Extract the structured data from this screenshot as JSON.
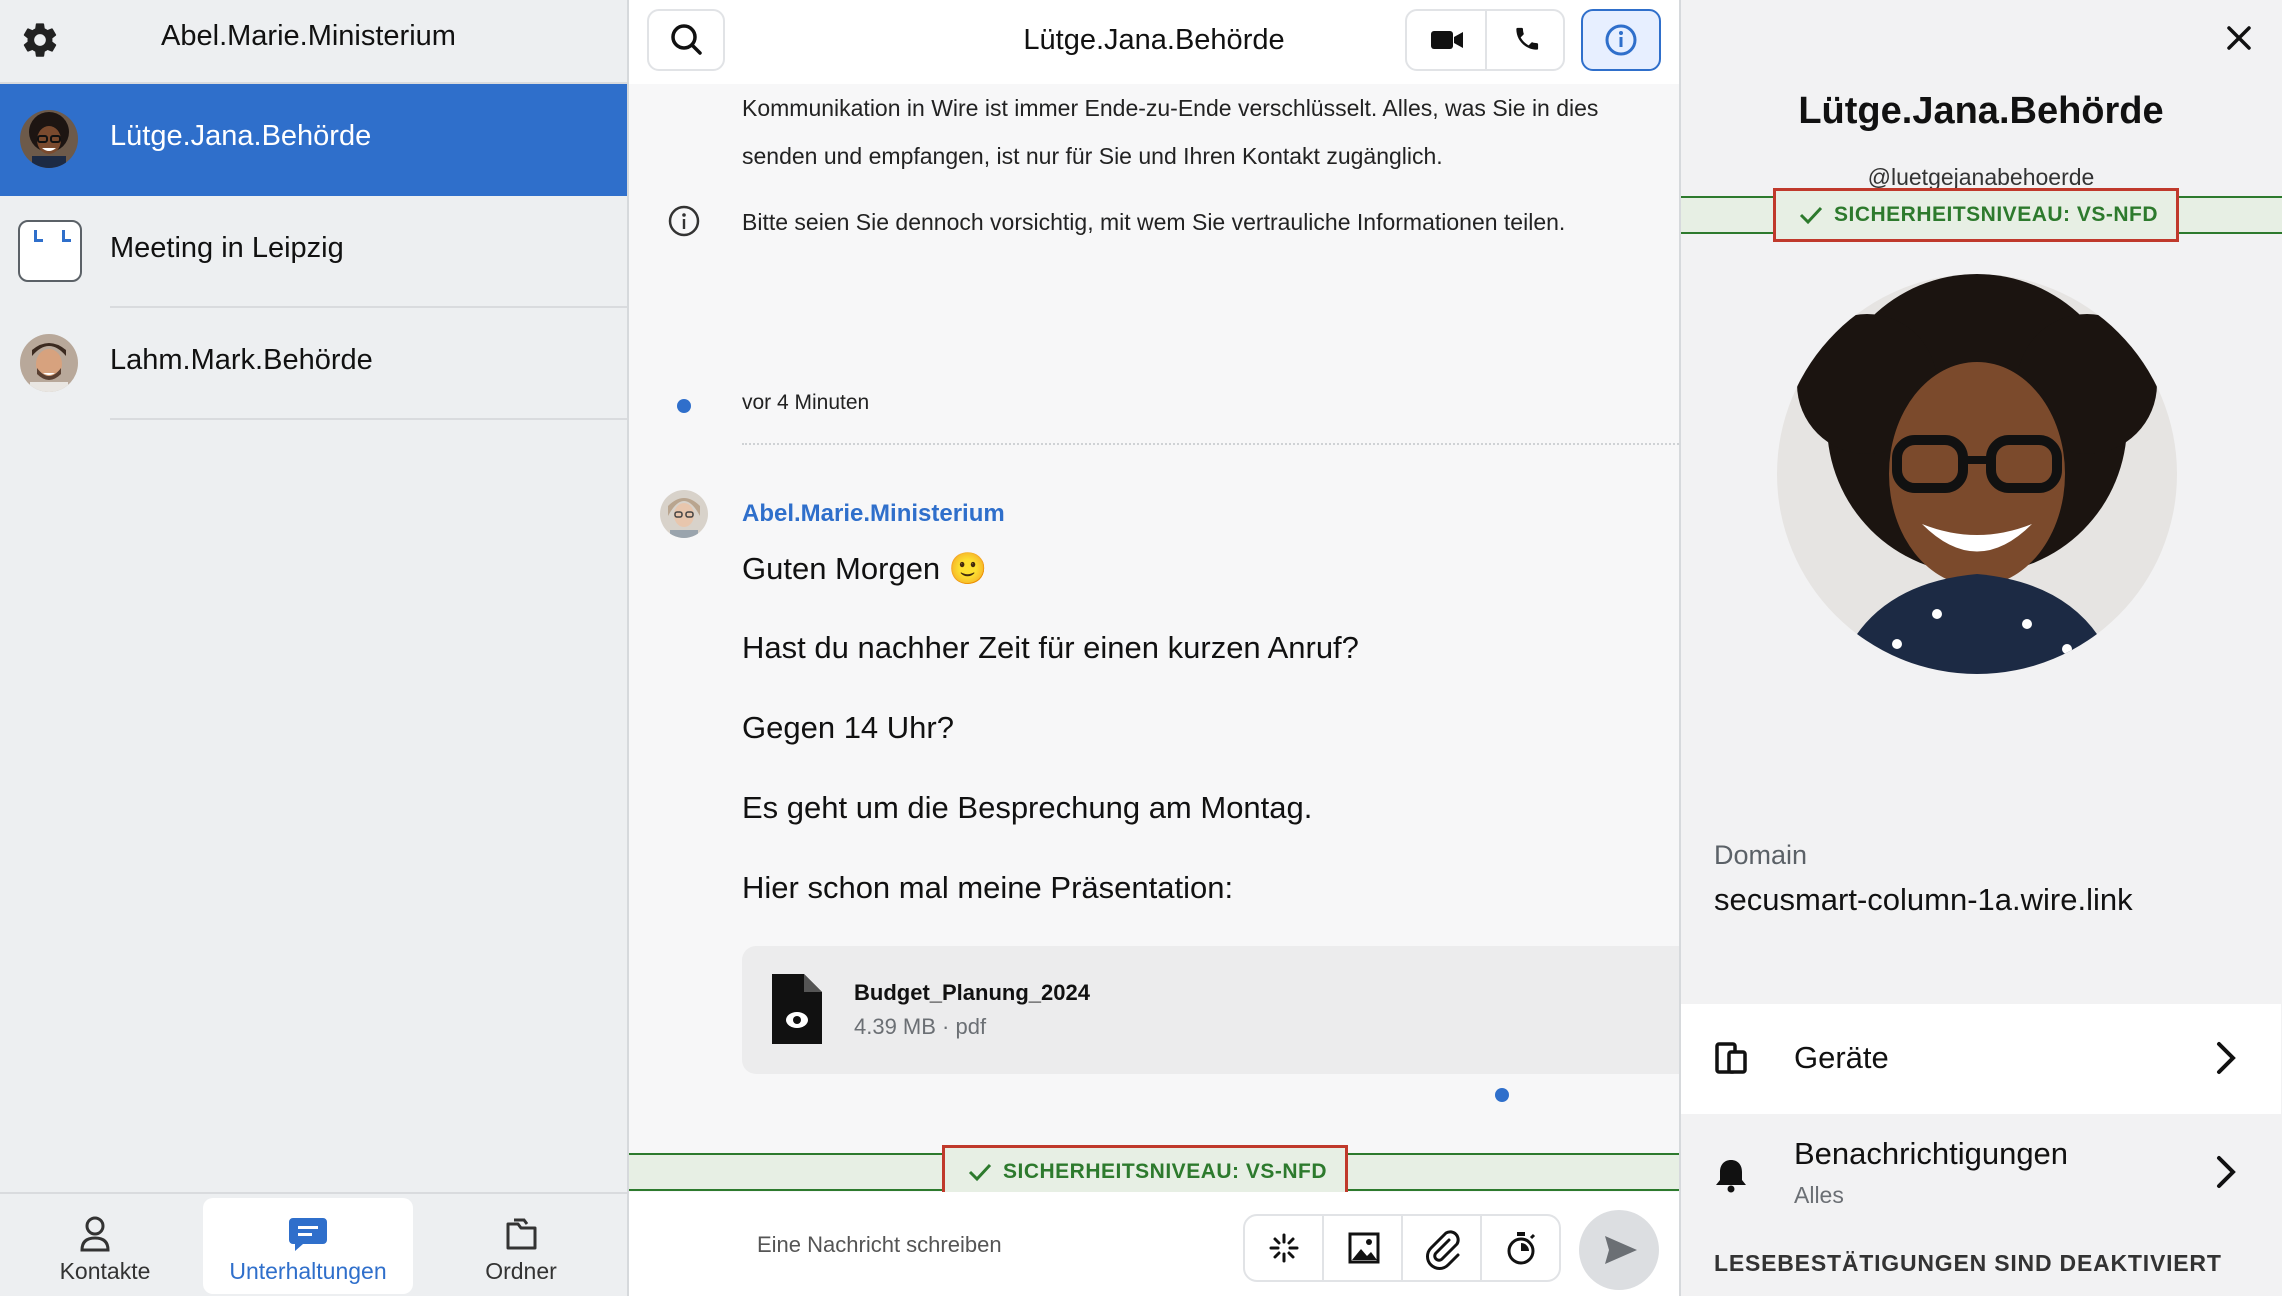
{
  "sidebar": {
    "title": "Abel.Marie.Ministerium",
    "conversations": [
      {
        "name": "Lütge.Jana.Behörde",
        "active": true
      },
      {
        "name": "Meeting in Leipzig",
        "active": false
      },
      {
        "name": "Lahm.Mark.Behörde",
        "active": false
      }
    ],
    "nav": [
      {
        "label": "Kontakte",
        "icon": "contacts-icon"
      },
      {
        "label": "Unterhaltungen",
        "icon": "conversations-icon",
        "active": true
      },
      {
        "label": "Ordner",
        "icon": "folder-icon"
      }
    ]
  },
  "conversation": {
    "title": "Lütge.Jana.Behörde",
    "system_line_1": "Kommunikation in Wire ist immer Ende-zu-Ende verschlüsselt. Alles, was Sie in dies",
    "system_line_2": "senden und empfangen, ist nur für Sie und Ihren Kontakt zugänglich.",
    "system_line_3": "Bitte seien Sie dennoch vorsichtig, mit wem Sie vertrauliche Informationen teilen.",
    "timestamp": "vor 4 Minuten",
    "sender": "Abel.Marie.Ministerium",
    "messages": [
      "Guten Morgen 🙂",
      "Hast du nachher Zeit für einen kurzen Anruf?",
      "Gegen 14 Uhr?",
      "Es geht um die Besprechung am Montag.",
      "Hier schon mal meine Präsentation:"
    ],
    "file": {
      "name": "Budget_Planung_2024",
      "meta": "4.39 MB · pdf"
    },
    "security_label": "SICHERHEITSNIVEAU: VS-NFD",
    "composer_placeholder": "Eine Nachricht schreiben"
  },
  "panel": {
    "name": "Lütge.Jana.Behörde",
    "handle": "@luetgejanabehoerde",
    "security_label": "SICHERHEITSNIVEAU: VS-NFD",
    "domain_label": "Domain",
    "domain_value": "secusmart-column-1a.wire.link",
    "devices_label": "Geräte",
    "notifications_label": "Benachrichtigungen",
    "notifications_value": "Alles",
    "receipts_label": "LESEBESTÄTIGUNGEN SIND DEAKTIVIERT"
  },
  "colors": {
    "accent": "#2f6fcb",
    "security_green": "#2d7a2d",
    "highlight_red": "#c0392b"
  }
}
